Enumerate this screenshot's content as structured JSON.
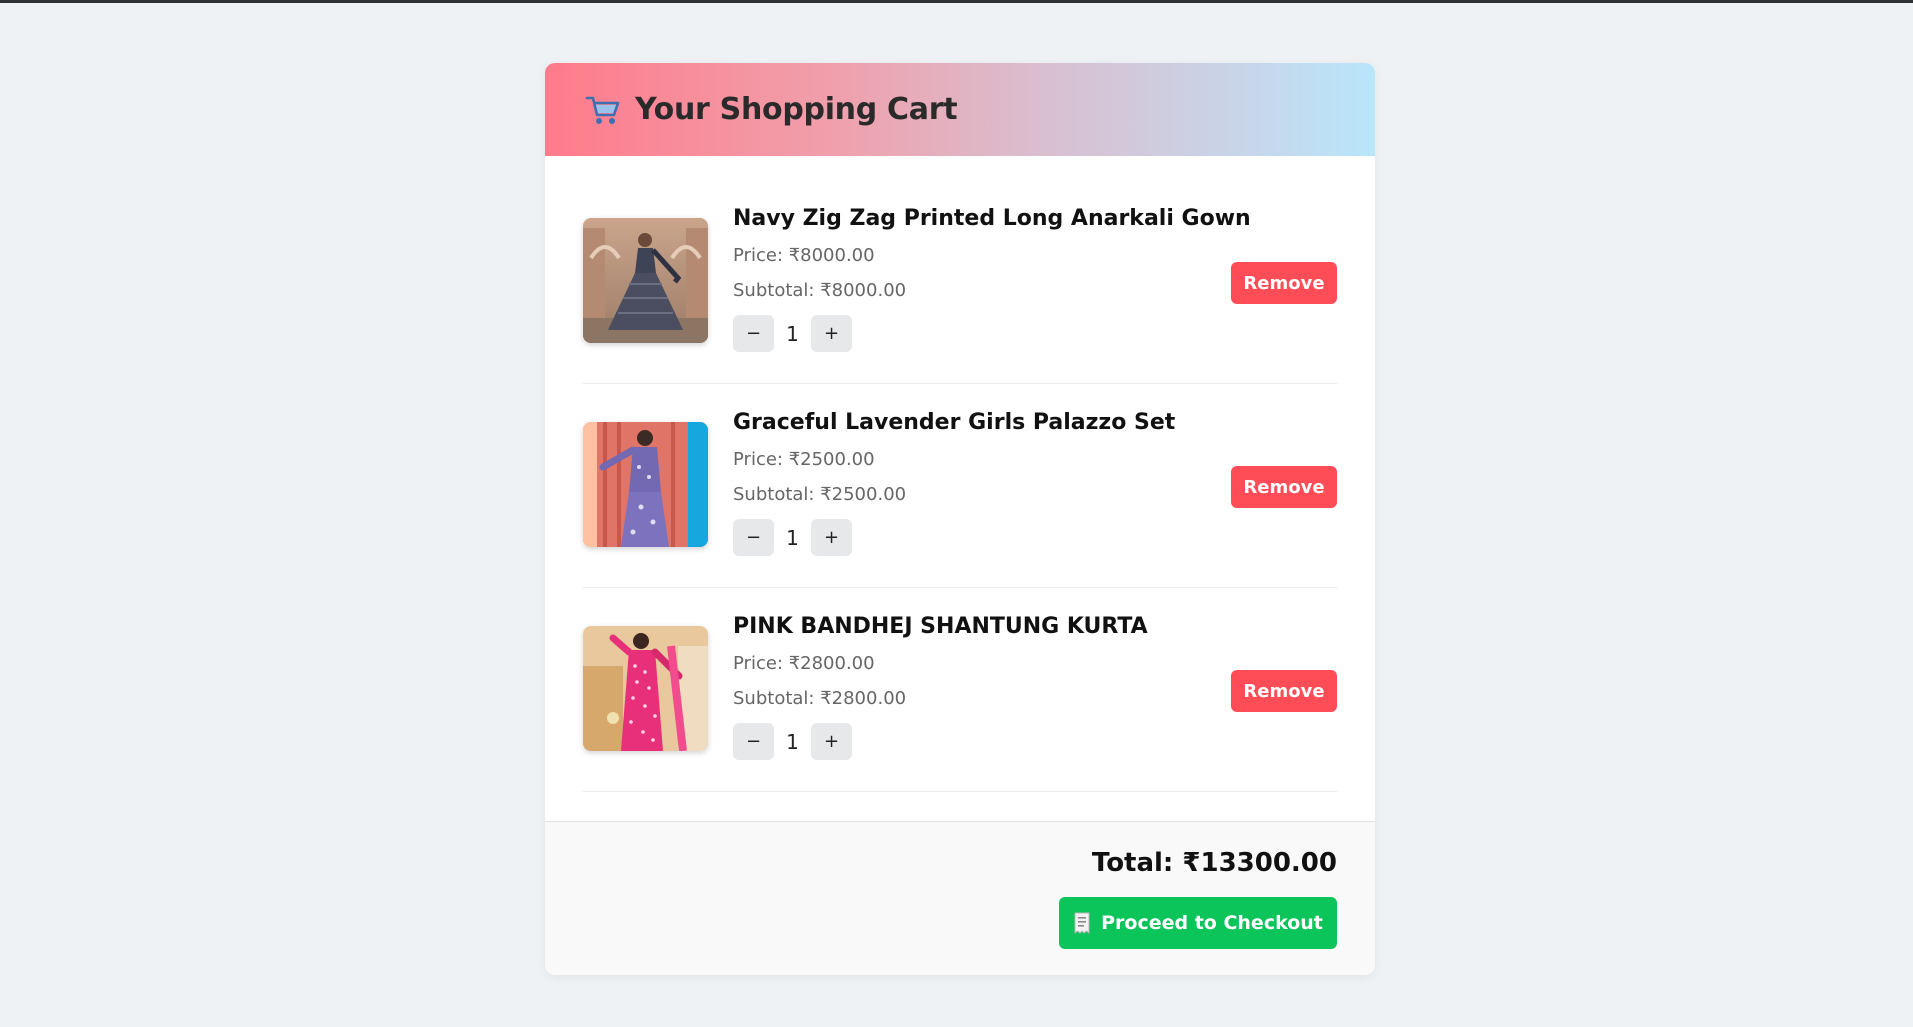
{
  "header": {
    "title": "Your Shopping Cart",
    "icon": "shopping-cart-icon"
  },
  "items": [
    {
      "name": "Navy Zig Zag Printed Long Anarkali Gown",
      "price": "Price: ₹8000.00",
      "subtotal": "Subtotal: ₹8000.00",
      "quantity": "1",
      "minus_label": "−",
      "plus_label": "+",
      "remove_label": "Remove",
      "image": "navy-anarkali-gown-photo"
    },
    {
      "name": "Graceful Lavender Girls Palazzo Set",
      "price": "Price: ₹2500.00",
      "subtotal": "Subtotal: ₹2500.00",
      "quantity": "1",
      "minus_label": "−",
      "plus_label": "+",
      "remove_label": "Remove",
      "image": "lavender-palazzo-set-photo"
    },
    {
      "name": "PINK BANDHEJ SHANTUNG KURTA",
      "price": "Price: ₹2800.00",
      "subtotal": "Subtotal: ₹2800.00",
      "quantity": "1",
      "minus_label": "−",
      "plus_label": "+",
      "remove_label": "Remove",
      "image": "pink-bandhej-kurta-photo"
    }
  ],
  "footer": {
    "total": "Total: ₹13300.00",
    "checkout_label": "Proceed to Checkout",
    "checkout_icon": "receipt-icon"
  },
  "colors": {
    "remove": "#ff4d57",
    "checkout": "#0bc45a",
    "header_gradient_start": "#ff7b8b",
    "header_gradient_end": "#b8e6fb"
  }
}
